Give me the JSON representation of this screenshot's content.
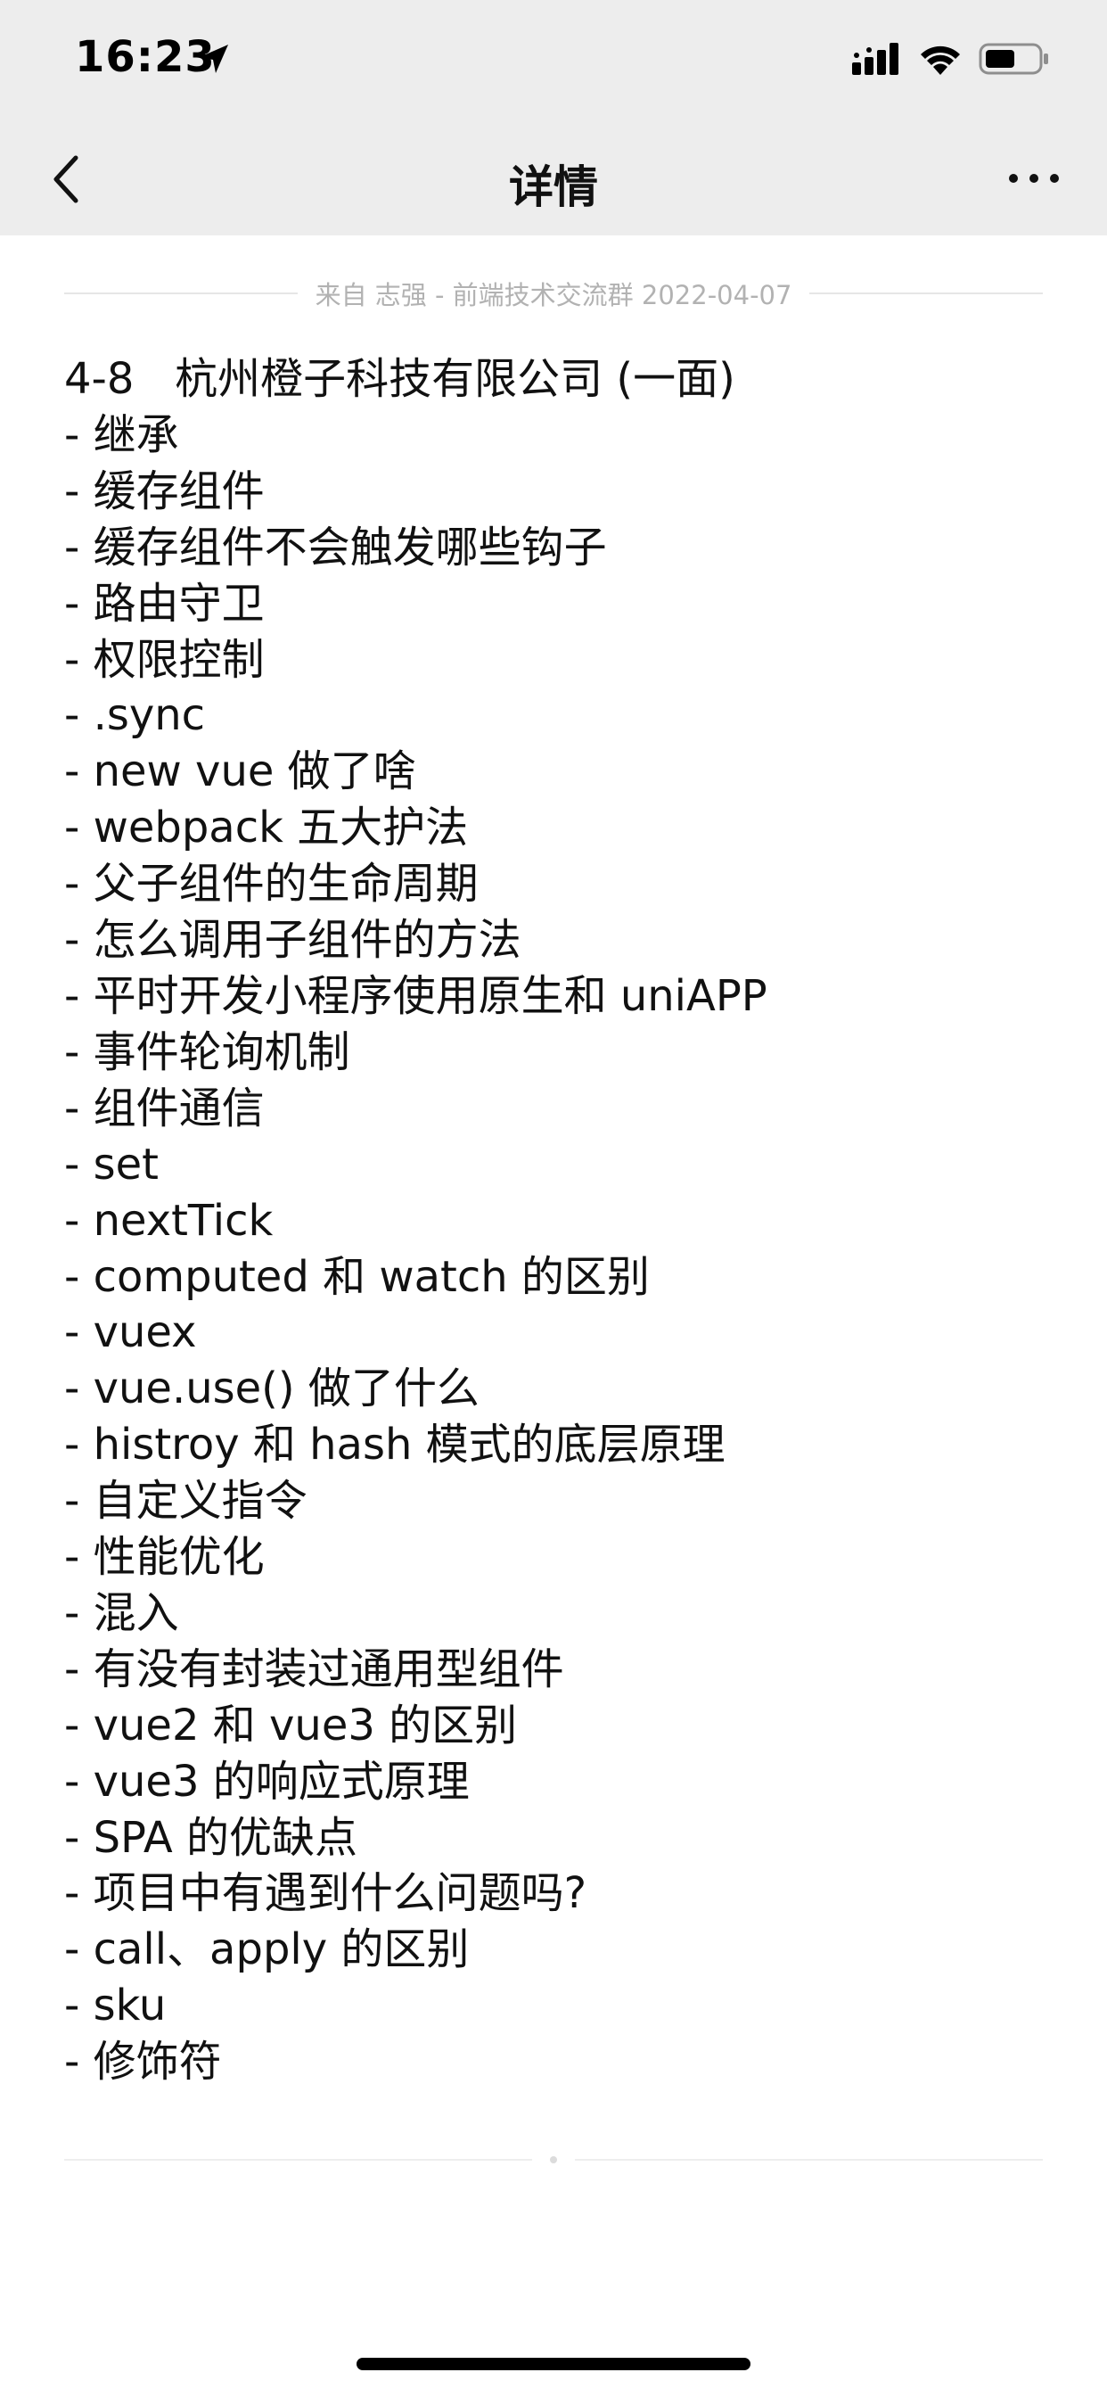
{
  "status_bar": {
    "time": "16:23"
  },
  "nav": {
    "title": "详情"
  },
  "meta": {
    "source": "来自 志强 - 前端技术交流群 2022-04-07"
  },
  "content": {
    "lines": [
      "4-8   杭州橙子科技有限公司 (一面)",
      "- 继承",
      "- 缓存组件",
      "- 缓存组件不会触发哪些钩子",
      "- 路由守卫",
      "- 权限控制",
      "- .sync",
      "- new vue 做了啥",
      "- webpack 五大护法",
      "- 父子组件的生命周期",
      "- 怎么调用子组件的方法",
      "- 平时开发小程序使用原生和 uniAPP",
      "- 事件轮询机制",
      "- 组件通信",
      "- set",
      "- nextTick",
      "- computed 和 watch 的区别",
      "- vuex",
      "- vue.use() 做了什么",
      "- histroy 和 hash 模式的底层原理",
      "- 自定义指令",
      "- 性能优化",
      "- 混入",
      "- 有没有封装过通用型组件",
      "- vue2 和 vue3 的区别",
      "- vue3 的响应式原理",
      "- SPA 的优缺点",
      "- 项目中有遇到什么问题吗?",
      "- call、apply 的区别",
      "- sku",
      "- 修饰符"
    ]
  },
  "icons": {
    "location": "location-arrow-icon",
    "signal": "cellular-signal-icon",
    "wifi": "wifi-icon",
    "battery": "battery-icon",
    "back": "chevron-left-icon",
    "more": "more-dots-icon"
  },
  "colors": {
    "bar_background": "#ededed",
    "page_background": "#ffffff",
    "meta_text": "#b2b2b2",
    "body_text": "#111111"
  }
}
